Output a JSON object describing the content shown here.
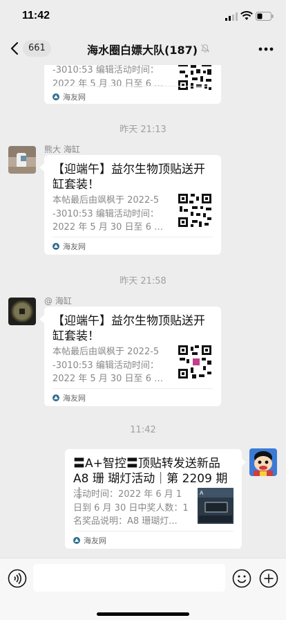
{
  "status": {
    "time": "11:42"
  },
  "header": {
    "back_count": "661",
    "title": "海水圈白嫖大队(187)"
  },
  "messages": [
    {
      "kind": "card",
      "side": "left",
      "desc_lines": [
        "-3010:53 编辑活动时间：",
        "2022 年 5 月 30 日至 6 月..."
      ],
      "source": "海友网"
    },
    {
      "kind": "time",
      "text": "昨天 21:13"
    },
    {
      "kind": "card",
      "side": "left",
      "sender": "熊大 海缸",
      "title": "【迎端午】益尔生物顶贴送开缸套装！",
      "desc_lines": [
        "本帖最后由飒枫于 2022-5",
        "-3010:53 编辑活动时间：",
        "2022 年 5 月 30 日至 6 月..."
      ],
      "source": "海友网"
    },
    {
      "kind": "time",
      "text": "昨天 21:58"
    },
    {
      "kind": "card",
      "side": "left",
      "sender": "@ 海缸",
      "title": "【迎端午】益尔生物顶贴送开缸套装！",
      "desc_lines": [
        "本帖最后由飒枫于 2022-5",
        "-3010:53 编辑活动时间：",
        "2022 年 5 月 30 日至 6 月..."
      ],
      "source": "海友网"
    },
    {
      "kind": "time",
      "text": "11:42"
    },
    {
      "kind": "card",
      "side": "right",
      "title": "〓A+智控〓顶贴转发送新品 A8 珊 瑚灯活动｜第 2209 期｜",
      "desc_lines": [
        "活动时间：2022 年 6 月 1",
        "日到 6 月 30 日中奖人数：1",
        "名奖品说明：A8 珊瑚灯..."
      ],
      "source": "海友网"
    }
  ],
  "colors": {
    "background": "#ededed",
    "card": "#ffffff",
    "meta_text": "#888888",
    "time_text": "#a0a0a0"
  },
  "icons": [
    "back-icon",
    "mute-icon",
    "more-icon",
    "voice-icon",
    "emoji-icon",
    "add-icon",
    "signal-icon",
    "wifi-icon",
    "battery-icon"
  ]
}
